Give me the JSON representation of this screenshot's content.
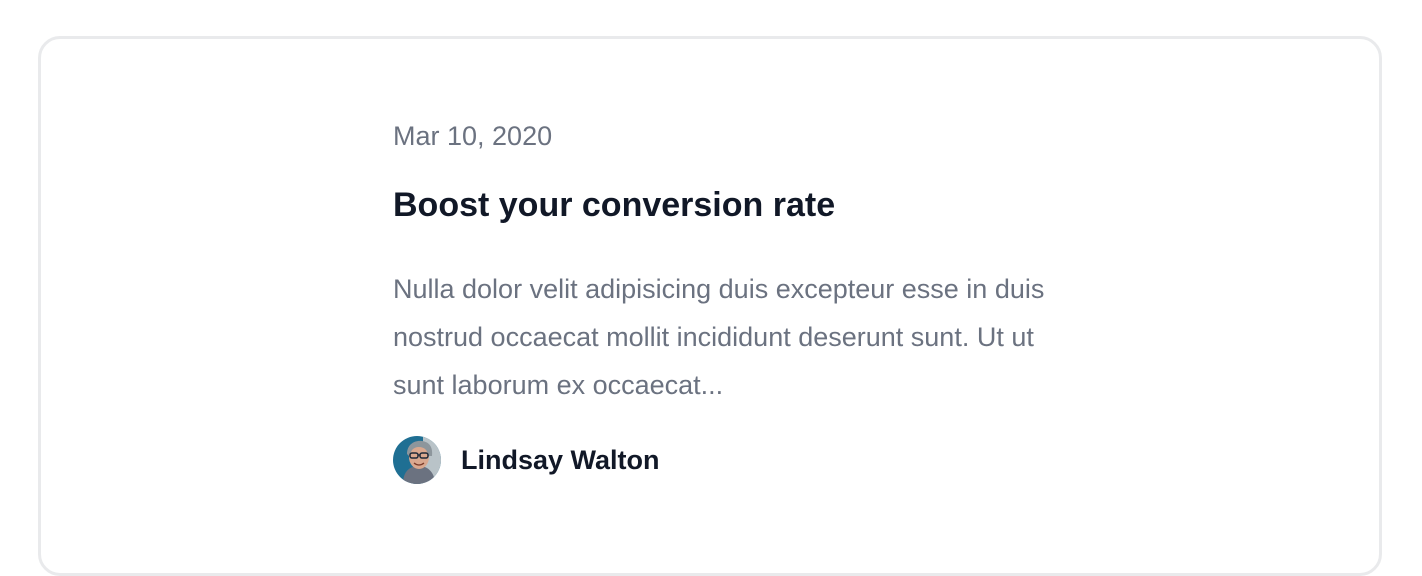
{
  "post": {
    "date": "Mar 10, 2020",
    "title": "Boost your conversion rate",
    "excerpt": "Nulla dolor velit adipisicing duis excepteur esse in duis nostrud occaecat mollit incididunt deserunt sunt. Ut ut sunt laborum ex occaecat...",
    "author": {
      "name": "Lindsay Walton"
    }
  },
  "colors": {
    "muted_text": "#6b7280",
    "heading_text": "#111827",
    "card_border": "#e9eaec"
  }
}
